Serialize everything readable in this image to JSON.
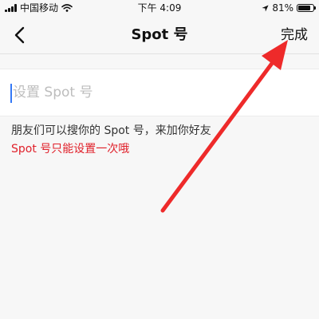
{
  "status_bar": {
    "carrier": "中国移动",
    "time": "下午 4:09",
    "battery_percent": "81%",
    "battery_level": 0.81
  },
  "nav": {
    "title": "Spot 号",
    "done_label": "完成",
    "back_icon": "chevron-left-icon"
  },
  "input": {
    "value": "",
    "placeholder": "设置 Spot 号"
  },
  "hints": {
    "primary": "朋友们可以搜你的 Spot 号，来加你好友",
    "warning": "Spot 号只能设置一次哦"
  },
  "colors": {
    "background": "#f7f7f7",
    "warning": "#e0202a",
    "cursor": "#3478f6",
    "annotation_arrow": "#ee2a2a"
  }
}
